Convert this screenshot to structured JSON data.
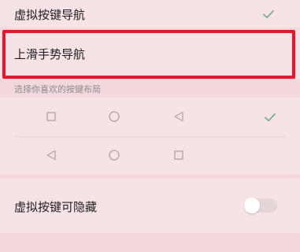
{
  "navigation_settings": {
    "virtual_keys_nav": {
      "label": "虚拟按键导航",
      "selected": true
    },
    "swipe_up_gestures": {
      "label": "上滑手势导航",
      "highlighted": true
    },
    "section_label": "选择你喜欢的按键布局",
    "layouts": [
      {
        "icons": [
          "square-icon",
          "circle-icon",
          "triangle-left-icon"
        ],
        "selected": true
      },
      {
        "icons": [
          "triangle-left-icon",
          "circle-icon",
          "square-icon"
        ],
        "selected": false
      }
    ],
    "hideable_virtual_keys": {
      "label": "虚拟按键可隐藏",
      "enabled": false
    }
  },
  "colors": {
    "highlight_border": "#f0112a",
    "background": "#f2d8dc",
    "card_background": "#f7e3e6",
    "check_color": "#74b08b",
    "icon_gray": "#a9a5a6",
    "label_gray": "#8c8c8c"
  }
}
